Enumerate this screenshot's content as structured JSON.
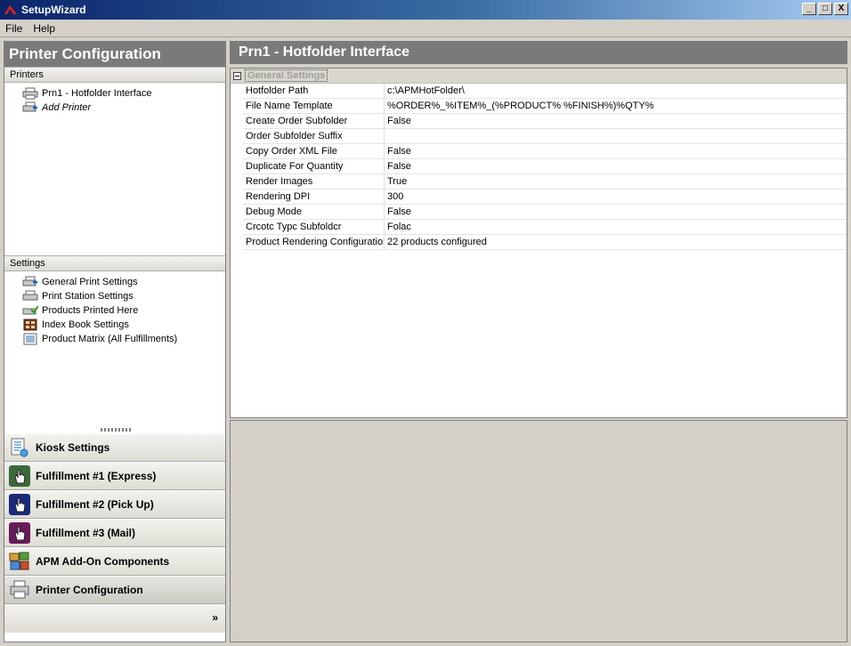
{
  "window": {
    "title": "SetupWizard",
    "minimize": "_",
    "maximize": "□",
    "close": "X"
  },
  "menu": {
    "items": [
      "File",
      "Help"
    ]
  },
  "left": {
    "title": "Printer Configuration",
    "printers_heading": "Printers",
    "printers": [
      "Prn1 - Hotfolder Interface",
      "Add Printer"
    ],
    "settings_heading": "Settings",
    "settings": [
      "General Print Settings",
      "Print Station Settings",
      "Products Printed Here",
      "Index Book Settings",
      "Product Matrix (All Fulfillments)"
    ],
    "nav": [
      "Kiosk Settings",
      "Fulfillment #1 (Express)",
      "Fulfillment #2 (Pick Up)",
      "Fulfillment #3 (Mail)",
      "APM Add-On Components",
      "Printer Configuration"
    ],
    "more_chevron": "»"
  },
  "right": {
    "title": "Prn1 - Hotfolder Interface",
    "category": "General Settings",
    "properties": [
      {
        "name": "Hotfolder Path",
        "value": "c:\\APMHotFolder\\"
      },
      {
        "name": "File Name Template",
        "value": "%ORDER%_%ITEM%_(%PRODUCT% %FINISH%)%QTY%"
      },
      {
        "name": "Create Order Subfolder",
        "value": "False"
      },
      {
        "name": "Order Subfolder Suffix",
        "value": ""
      },
      {
        "name": "Copy Order XML File",
        "value": "False"
      },
      {
        "name": "Duplicate For Quantity",
        "value": "False"
      },
      {
        "name": "Render Images",
        "value": "True"
      },
      {
        "name": "Rendering DPI",
        "value": "300"
      },
      {
        "name": "Debug Mode",
        "value": "False"
      },
      {
        "name": "Crcotc Typc Subfoldcr",
        "value": "Folac"
      },
      {
        "name": "Product Rendering Configuration",
        "value": "22 products configured"
      }
    ]
  }
}
